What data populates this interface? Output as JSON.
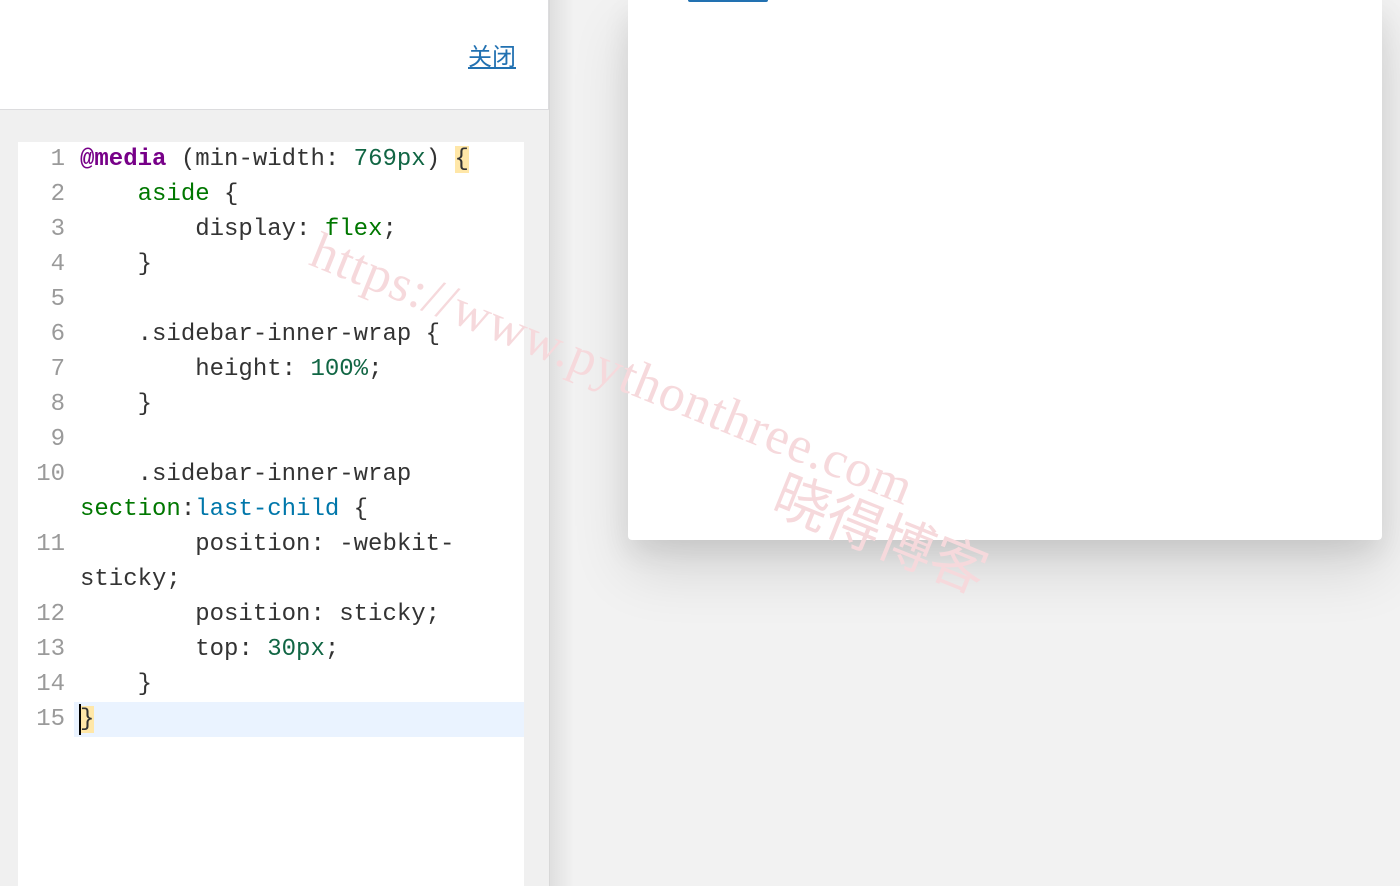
{
  "header": {
    "close_label": "关闭"
  },
  "editor": {
    "language": "css",
    "active_line": 15,
    "lines": [
      {
        "n": 1,
        "tokens": [
          [
            "at",
            "@media"
          ],
          [
            "plain",
            " ("
          ],
          [
            "rule",
            "min-width"
          ],
          [
            "plain",
            ": "
          ],
          [
            "num",
            "769px"
          ],
          [
            "plain",
            ") "
          ],
          [
            "brace",
            "{"
          ]
        ]
      },
      {
        "n": 2,
        "tokens": [
          [
            "plain",
            "    "
          ],
          [
            "kw",
            "aside"
          ],
          [
            "plain",
            " {"
          ]
        ]
      },
      {
        "n": 3,
        "tokens": [
          [
            "plain",
            "        "
          ],
          [
            "prop",
            "display"
          ],
          [
            "plain",
            ": "
          ],
          [
            "val",
            "flex"
          ],
          [
            "plain",
            ";"
          ]
        ]
      },
      {
        "n": 4,
        "tokens": [
          [
            "plain",
            "    }"
          ]
        ]
      },
      {
        "n": 5,
        "tokens": [
          [
            "plain",
            ""
          ]
        ]
      },
      {
        "n": 6,
        "tokens": [
          [
            "plain",
            "    "
          ],
          [
            "class",
            ".sidebar-inner-wrap"
          ],
          [
            "plain",
            " {"
          ]
        ]
      },
      {
        "n": 7,
        "tokens": [
          [
            "plain",
            "        "
          ],
          [
            "prop",
            "height"
          ],
          [
            "plain",
            ": "
          ],
          [
            "num",
            "100%"
          ],
          [
            "plain",
            ";"
          ]
        ]
      },
      {
        "n": 8,
        "tokens": [
          [
            "plain",
            "    }"
          ]
        ]
      },
      {
        "n": 9,
        "tokens": [
          [
            "plain",
            ""
          ]
        ]
      },
      {
        "n": 10,
        "wrap": true,
        "tokens": [
          [
            "plain",
            "    "
          ],
          [
            "class",
            ".sidebar-inner-wrap"
          ]
        ],
        "cont_tokens": [
          [
            "kw",
            "section"
          ],
          [
            "plain",
            ":"
          ],
          [
            "pseudo",
            "last-child"
          ],
          [
            "plain",
            " {"
          ]
        ]
      },
      {
        "n": 11,
        "wrap": true,
        "tokens": [
          [
            "plain",
            "        "
          ],
          [
            "prop",
            "position"
          ],
          [
            "plain",
            ": -webkit-"
          ]
        ],
        "cont_tokens": [
          [
            "plain",
            "sticky;"
          ]
        ]
      },
      {
        "n": 12,
        "tokens": [
          [
            "plain",
            "        "
          ],
          [
            "prop",
            "position"
          ],
          [
            "plain",
            ": sticky;"
          ]
        ]
      },
      {
        "n": 13,
        "tokens": [
          [
            "plain",
            "        "
          ],
          [
            "prop",
            "top"
          ],
          [
            "plain",
            ": "
          ],
          [
            "num",
            "30px"
          ],
          [
            "plain",
            ";"
          ]
        ]
      },
      {
        "n": 14,
        "tokens": [
          [
            "plain",
            "    }"
          ]
        ]
      },
      {
        "n": 15,
        "tokens": [
          [
            "brace",
            "}"
          ]
        ]
      }
    ]
  },
  "watermark": {
    "url": "https://www.pythonthree.com",
    "name": "晓得博客"
  }
}
